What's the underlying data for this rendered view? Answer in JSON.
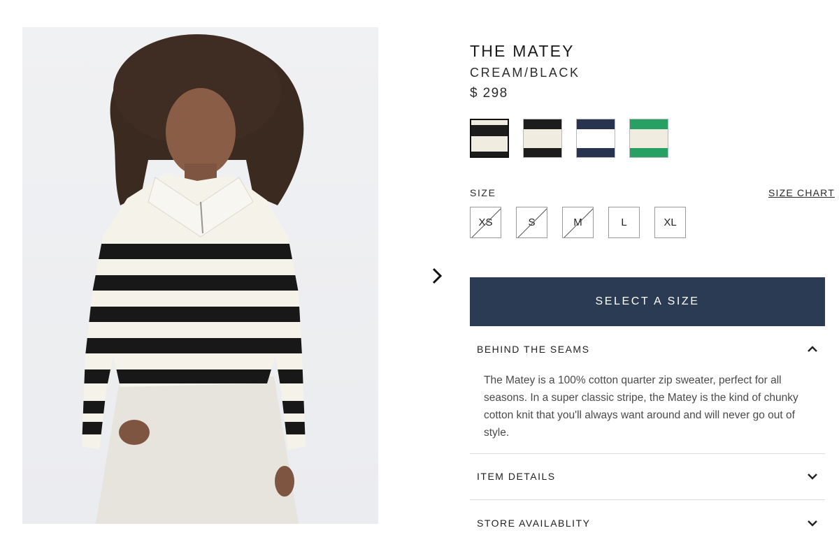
{
  "product": {
    "name": "THE MATEY",
    "color": "CREAM/BLACK",
    "price": "$ 298",
    "image_alt": "Model wearing cream and black striped quarter zip sweater"
  },
  "gallery": {
    "next_icon": "chevron-right-icon"
  },
  "swatches": [
    {
      "name": "cream/black",
      "colors": [
        "#f1ece0",
        "#1c1c1c"
      ],
      "selected": true
    },
    {
      "name": "black/cream",
      "colors": [
        "#1c1c1c",
        "#f1ece0"
      ],
      "selected": false
    },
    {
      "name": "navy/white",
      "colors": [
        "#28344f",
        "#ffffff"
      ],
      "selected": false
    },
    {
      "name": "green/cream",
      "colors": [
        "#27a064",
        "#f1ece0"
      ],
      "selected": false
    }
  ],
  "size": {
    "label": "SIZE",
    "chart_link": "SIZE CHART",
    "options": [
      {
        "label": "XS",
        "available": false
      },
      {
        "label": "S",
        "available": false
      },
      {
        "label": "M",
        "available": false
      },
      {
        "label": "L",
        "available": true
      },
      {
        "label": "XL",
        "available": true
      }
    ]
  },
  "cta": {
    "label": "SELECT A SIZE",
    "color": "#2c3b54"
  },
  "accordion": [
    {
      "title": "BEHIND THE SEAMS",
      "expanded": true,
      "icon": "chevron-up-icon",
      "body": "The Matey is a 100% cotton quarter zip sweater, perfect for all seasons. In a super classic stripe, the Matey is the kind of chunky cotton knit that you'll always want around and will never go out of style."
    },
    {
      "title": "ITEM DETAILS",
      "expanded": false,
      "icon": "chevron-down-icon"
    },
    {
      "title": "STORE AVAILABLITY",
      "expanded": false,
      "icon": "chevron-down-icon"
    }
  ]
}
